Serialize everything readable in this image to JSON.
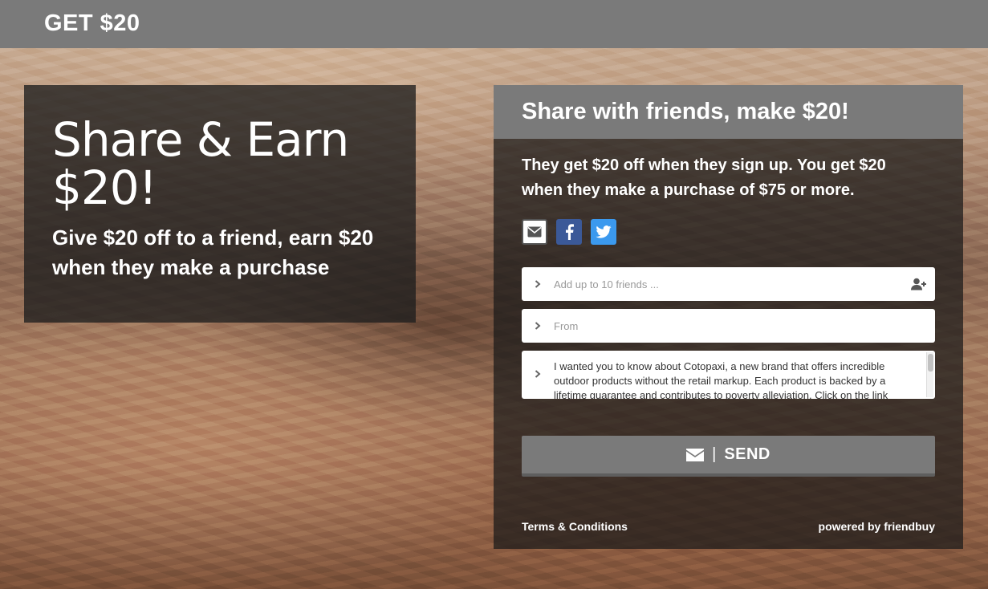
{
  "topbar": {
    "brand": "GET $20"
  },
  "hero": {
    "title": "Share & Earn $20!",
    "subtitle": "Give $20 off to a friend, earn $20 when they make a purchase"
  },
  "panel": {
    "header": "Share with friends, make $20!",
    "description": "They get $20 off when they sign up. You get $20 when they make a purchase of $75 or more.",
    "socials": [
      {
        "icon": "envelope-icon",
        "color": "#ffffff"
      },
      {
        "icon": "facebook-icon",
        "color": "#3b5998"
      },
      {
        "icon": "twitter-icon",
        "color": "#3b99ee"
      }
    ],
    "friends_placeholder": "Add up to 10 friends ...",
    "from_placeholder": "From",
    "message": "I wanted you to know about Cotopaxi, a new brand that offers incredible outdoor products without the retail markup. Each product is backed by a lifetime guarantee and contributes to poverty alleviation. Click on the link",
    "send_label": "SEND",
    "terms_label": "Terms & Conditions",
    "powered_label": "powered by friendbuy"
  },
  "colors": {
    "bar_gray": "#7a7a7a",
    "facebook": "#3b5998",
    "twitter": "#3b99ee"
  }
}
